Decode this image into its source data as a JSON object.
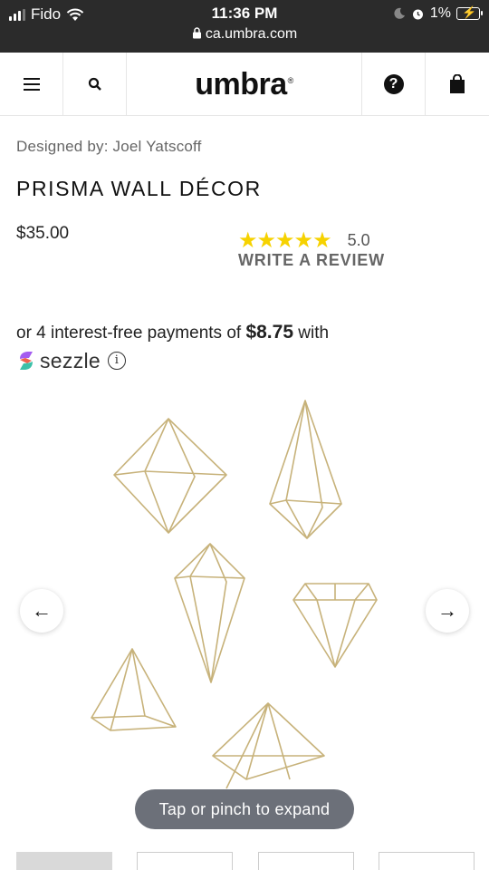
{
  "status_bar": {
    "carrier": "Fido",
    "time": "11:36 PM",
    "url": "ca.umbra.com",
    "battery": "1%"
  },
  "header": {
    "logo": "umbra",
    "logo_mark": "®"
  },
  "product": {
    "designer": "Designed by: Joel Yatscoff",
    "title": "PRISMA WALL DÉCOR",
    "price": "$35.00",
    "rating_stars": "★★★★★",
    "rating_value": "5.0",
    "write_review": "WRITE A REVIEW"
  },
  "payment": {
    "prefix": "or 4 interest-free payments of",
    "amount": "$8.75",
    "suffix": "with",
    "provider": "sezzle",
    "info_glyph": "i"
  },
  "gallery": {
    "prev_arrow": "←",
    "next_arrow": "→",
    "hint": "Tap or pinch to expand"
  },
  "colors": {
    "status_bar_bg": "#2b2b2b",
    "star": "#f6d200",
    "brass": "#c7b27a"
  },
  "icons": [
    "hamburger-menu-icon",
    "search-icon",
    "help-icon",
    "shopping-bag-icon",
    "wifi-icon",
    "lock-icon",
    "moon-icon",
    "alarm-icon",
    "battery-icon",
    "sezzle-logo-icon",
    "info-icon"
  ]
}
